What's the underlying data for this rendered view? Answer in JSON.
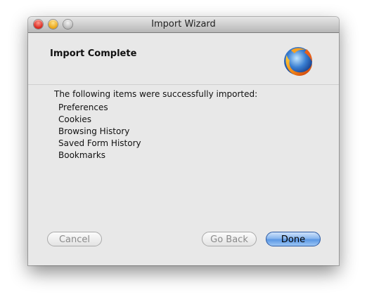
{
  "window": {
    "title": "Import Wizard"
  },
  "page": {
    "heading": "Import Complete",
    "intro": "The following items were successfully imported:",
    "items": [
      "Preferences",
      "Cookies",
      "Browsing History",
      "Saved Form History",
      "Bookmarks"
    ]
  },
  "buttons": {
    "cancel": "Cancel",
    "back": "Go Back",
    "done": "Done"
  },
  "icons": {
    "logo": "firefox-logo-icon"
  },
  "colors": {
    "window_bg": "#e8e8e8",
    "done_button": "#5b97e4",
    "close_button": "#d8241b",
    "minimize_button": "#e9a415"
  }
}
